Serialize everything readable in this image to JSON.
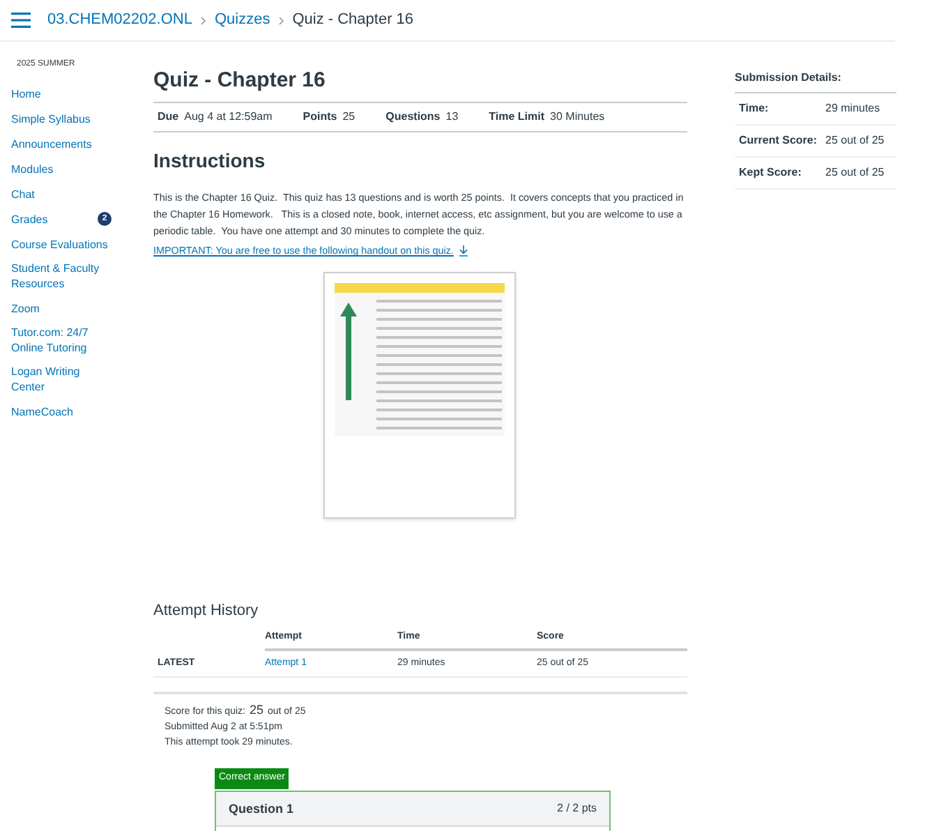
{
  "breadcrumbs": [
    {
      "label": "03.CHEM02202.ONL",
      "current": false
    },
    {
      "label": "Quizzes",
      "current": false
    },
    {
      "label": "Quiz - Chapter 16",
      "current": true
    }
  ],
  "sidebar": {
    "term": "2025 SUMMER",
    "items": [
      {
        "label": "Home"
      },
      {
        "label": "Simple Syllabus"
      },
      {
        "label": "Announcements"
      },
      {
        "label": "Modules"
      },
      {
        "label": "Chat"
      },
      {
        "label": "Grades",
        "badge": "2"
      },
      {
        "label": "Course Evaluations"
      },
      {
        "label": "Student & Faculty Resources"
      },
      {
        "label": "Zoom"
      },
      {
        "label": "Tutor.com: 24/7 Online Tutoring"
      },
      {
        "label": "Logan Writing Center"
      },
      {
        "label": "NameCoach"
      }
    ]
  },
  "quiz": {
    "title": "Quiz - Chapter 16",
    "details": [
      {
        "label": "Due",
        "value": "Aug 4 at 12:59am"
      },
      {
        "label": "Points",
        "value": "25"
      },
      {
        "label": "Questions",
        "value": "13"
      },
      {
        "label": "Time Limit",
        "value": "30 Minutes"
      }
    ],
    "instructions_heading": "Instructions",
    "instructions": "This is the Chapter 16 Quiz.  This quiz has 13 questions and is worth 25 points.  It covers concepts that you practiced in the Chapter 16 Homework.   This is a closed note, book, internet access, etc assignment, but you are welcome to use a periodic table.  You have one attempt and 30 minutes to complete the quiz.",
    "handout_link": "IMPORTANT: You are free to use the following handout on this quiz."
  },
  "attempt_history": {
    "heading": "Attempt History",
    "columns": [
      "Attempt",
      "Time",
      "Score"
    ],
    "rows": [
      {
        "label": "LATEST",
        "attempt": "Attempt 1",
        "time": "29 minutes",
        "score": "25 out of 25"
      }
    ]
  },
  "result": {
    "score_label": "Score for this quiz:",
    "score_value": "25",
    "score_suffix": "out of 25",
    "submitted": "Submitted Aug 2 at 5:51pm",
    "duration": "This attempt took 29 minutes."
  },
  "question": {
    "tag": "Correct answer",
    "title": "Question 1",
    "points": "2 / 2 pts"
  },
  "submission_details": {
    "heading": "Submission Details:",
    "rows": [
      {
        "label": "Time:",
        "value": "29 minutes"
      },
      {
        "label": "Current Score:",
        "value": "25 out of 25"
      },
      {
        "label": "Kept Score:",
        "value": "25 out of 25"
      }
    ]
  }
}
